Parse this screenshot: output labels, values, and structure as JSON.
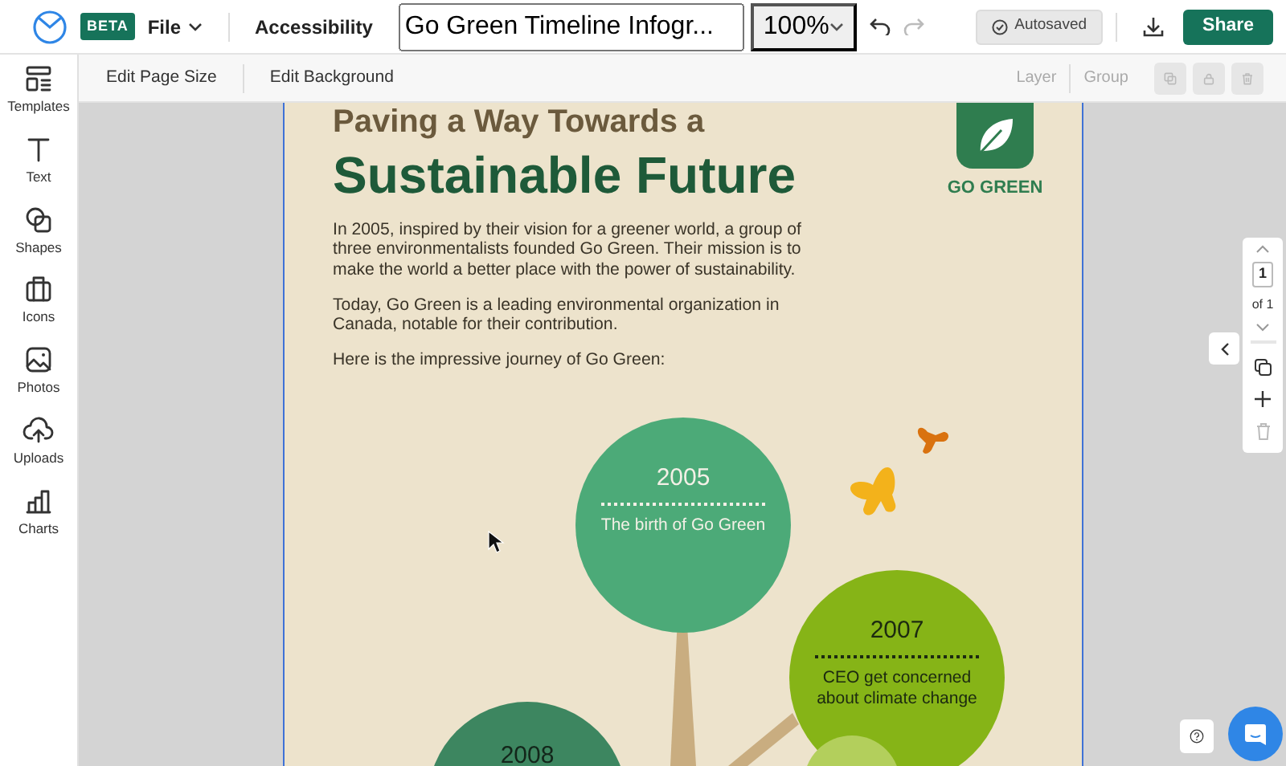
{
  "app": {
    "badge": "BETA",
    "menu": "File",
    "accessibility": "Accessibility",
    "document_title": "Go Green Timeline Infogr...",
    "zoom": "100%",
    "undo_disabled": false,
    "redo_disabled": true,
    "autosave": "Autosaved",
    "share": "Share"
  },
  "toolbar": {
    "actions": [
      "Edit Page Size",
      "Edit Background"
    ],
    "arrange": [
      {
        "label": "Layer",
        "disabled": true
      },
      {
        "label": "Group",
        "disabled": true
      }
    ],
    "icon_buttons": [
      {
        "kind": "copy",
        "disabled": true
      },
      {
        "kind": "lock",
        "disabled": true
      },
      {
        "kind": "trash",
        "disabled": true
      }
    ]
  },
  "sidebar": {
    "items": [
      {
        "kind": "templates",
        "label": "Templates"
      },
      {
        "kind": "text",
        "label": "Text"
      },
      {
        "kind": "shapes",
        "label": "Shapes"
      },
      {
        "kind": "icons",
        "label": "Icons"
      },
      {
        "kind": "photos",
        "label": "Photos"
      },
      {
        "kind": "uploads",
        "label": "Uploads"
      },
      {
        "kind": "charts",
        "label": "Charts"
      }
    ]
  },
  "poster": {
    "kicker": "Paving a Way Towards a",
    "title": "Sustainable Future",
    "logo_text": "GO GREEN",
    "paragraphs": [
      "In 2005, inspired by their vision for a greener world, a group of three environmentalists founded Go Green. Their mission is to make the world a better place with the power of sustainability.",
      "Today, Go Green is a leading environmental organization in Canada, notable for their contribution.",
      "Here is the impressive journey of Go Green:"
    ],
    "milestones": [
      {
        "year": "2005",
        "text": "The birth of Go Green",
        "color": "#4caa78"
      },
      {
        "year": "2007",
        "text": "CEO get concerned about climate change",
        "color": "#86b417"
      },
      {
        "year": "2008",
        "color": "#3d8660"
      }
    ]
  },
  "pager": {
    "page": "1",
    "total": "of 1",
    "delete_disabled": true
  }
}
